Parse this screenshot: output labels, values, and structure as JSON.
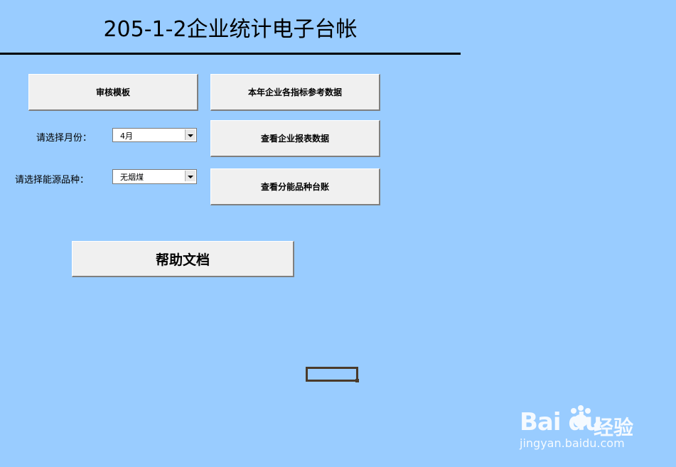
{
  "header": {
    "title": "205-1-2企业统计电子台帐"
  },
  "buttons": {
    "audit_template": "审核模板",
    "reference_data": "本年企业各指标参考数据",
    "view_report": "查看企业报表数据",
    "view_ledger": "查看分能品种台账",
    "help": "帮助文档"
  },
  "filters": {
    "month_label": "请选择月份：",
    "month_value": "4月",
    "energy_label": "请选择能源品种：",
    "energy_value": "无烟煤"
  },
  "watermark": {
    "logo": "Bai du",
    "brand": "经验",
    "url": "jingyan.baidu.com"
  },
  "colors": {
    "background": "#99ccff",
    "button_face": "#f0f0f0"
  }
}
